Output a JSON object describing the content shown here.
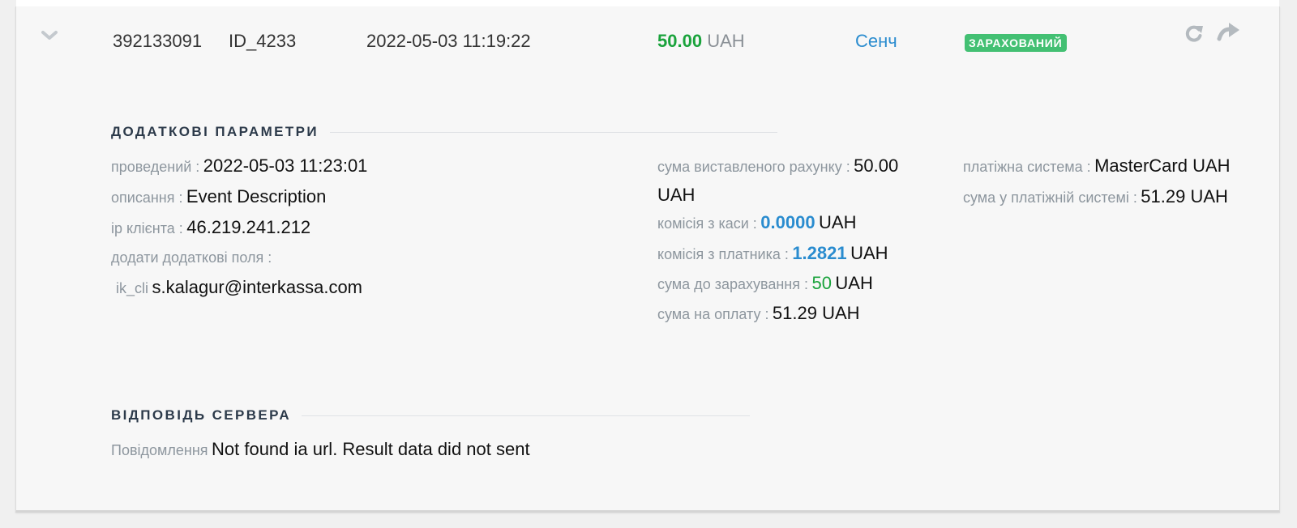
{
  "row": {
    "invoice_id": "392133091",
    "payment_id": "ID_4233",
    "datetime": "2022-05-03 11:19:22",
    "amount": "50.00",
    "currency": "UAH",
    "checkout_name": "Сенч",
    "status": "ЗАРАХОВАНИЙ",
    "icons": {
      "expand": "chevron-down-icon",
      "refresh": "refresh-icon",
      "resend": "forward-arrow-icon"
    }
  },
  "additional": {
    "title": "ДОДАТКОВІ ПАРАМЕТРИ",
    "processed_label": "проведений :",
    "processed_value": "2022-05-03 11:23:01",
    "description_label": "описання :",
    "description_value": "Event Description",
    "ip_label": "ip клієнта :",
    "ip_value": "46.219.241.212",
    "extra_fields_label": "додати додаткові поля :",
    "extra_field_key": "ik_cli",
    "extra_field_value": "s.kalagur@interkassa.com",
    "invoice_sum_label": "сума виставленого рахунку :",
    "invoice_sum_value": "50.00",
    "invoice_sum_currency": "UAH",
    "checkout_commission_label": "комісія з каси :",
    "checkout_commission_value": "0.0000",
    "checkout_commission_currency": "UAH",
    "payer_commission_label": "комісія з платника :",
    "payer_commission_value": "1.2821",
    "payer_commission_currency": "UAH",
    "credit_sum_label": "сума до зарахування :",
    "credit_sum_value": "50",
    "credit_sum_currency": "UAH",
    "pay_sum_label": "сума на оплату :",
    "pay_sum_value": "51.29 UAH",
    "paysystem_label": "платіжна система :",
    "paysystem_value": "MasterCard UAH",
    "paysystem_sum_label": "сума у платіжній системі :",
    "paysystem_sum_value": "51.29 UAH"
  },
  "server": {
    "title": "ВІДПОВІДЬ СЕРВЕРА",
    "message_label": "Повідомлення",
    "message_value": "Not found ia url. Result data did not sent"
  },
  "colors": {
    "success_green": "#1aa33c",
    "accent_blue": "#2a8ccf",
    "badge_green": "#43c073",
    "label_gray": "#8d969e"
  }
}
